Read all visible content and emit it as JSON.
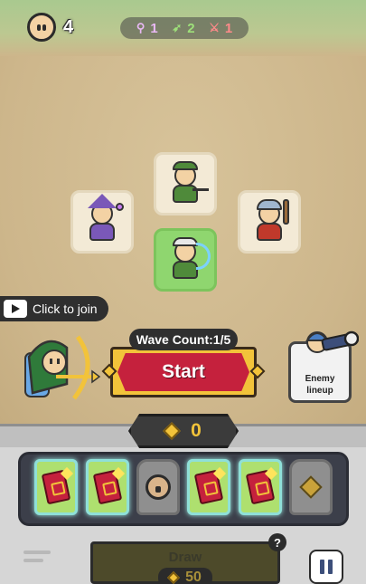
{
  "hud": {
    "coins": "4",
    "classes": [
      {
        "icon": "staff-icon",
        "count": "1",
        "color": "#e9b8f5"
      },
      {
        "icon": "bow-icon",
        "count": "2",
        "color": "#9ee07a"
      },
      {
        "icon": "sword-icon",
        "count": "1",
        "color": "#ff8a8a"
      }
    ]
  },
  "heroes": [
    {
      "name": "archer-top",
      "color": "#4f8a3a"
    },
    {
      "name": "wizard",
      "color": "#7a58b8"
    },
    {
      "name": "warrior",
      "color": "#c0392b"
    },
    {
      "name": "archer-active",
      "color": "#4f8a3a"
    }
  ],
  "join": {
    "label": "Click to join"
  },
  "wave": {
    "label": "Wave Count:1/5"
  },
  "start": {
    "label": "Start"
  },
  "enemy": {
    "label": "Enemy\nlineup"
  },
  "gold": {
    "value": "0"
  },
  "cards": [
    {
      "type": "spell-book"
    },
    {
      "type": "spell-book"
    },
    {
      "type": "locked-hero"
    },
    {
      "type": "spell-book"
    },
    {
      "type": "spell-book"
    },
    {
      "type": "locked-gem"
    }
  ],
  "draw": {
    "label": "Draw",
    "cost": "50"
  },
  "help": {
    "label": "?"
  },
  "colors": {
    "accent": "#c5213d",
    "gold": "#f2c33a",
    "active_slot": "#8fd66f"
  }
}
